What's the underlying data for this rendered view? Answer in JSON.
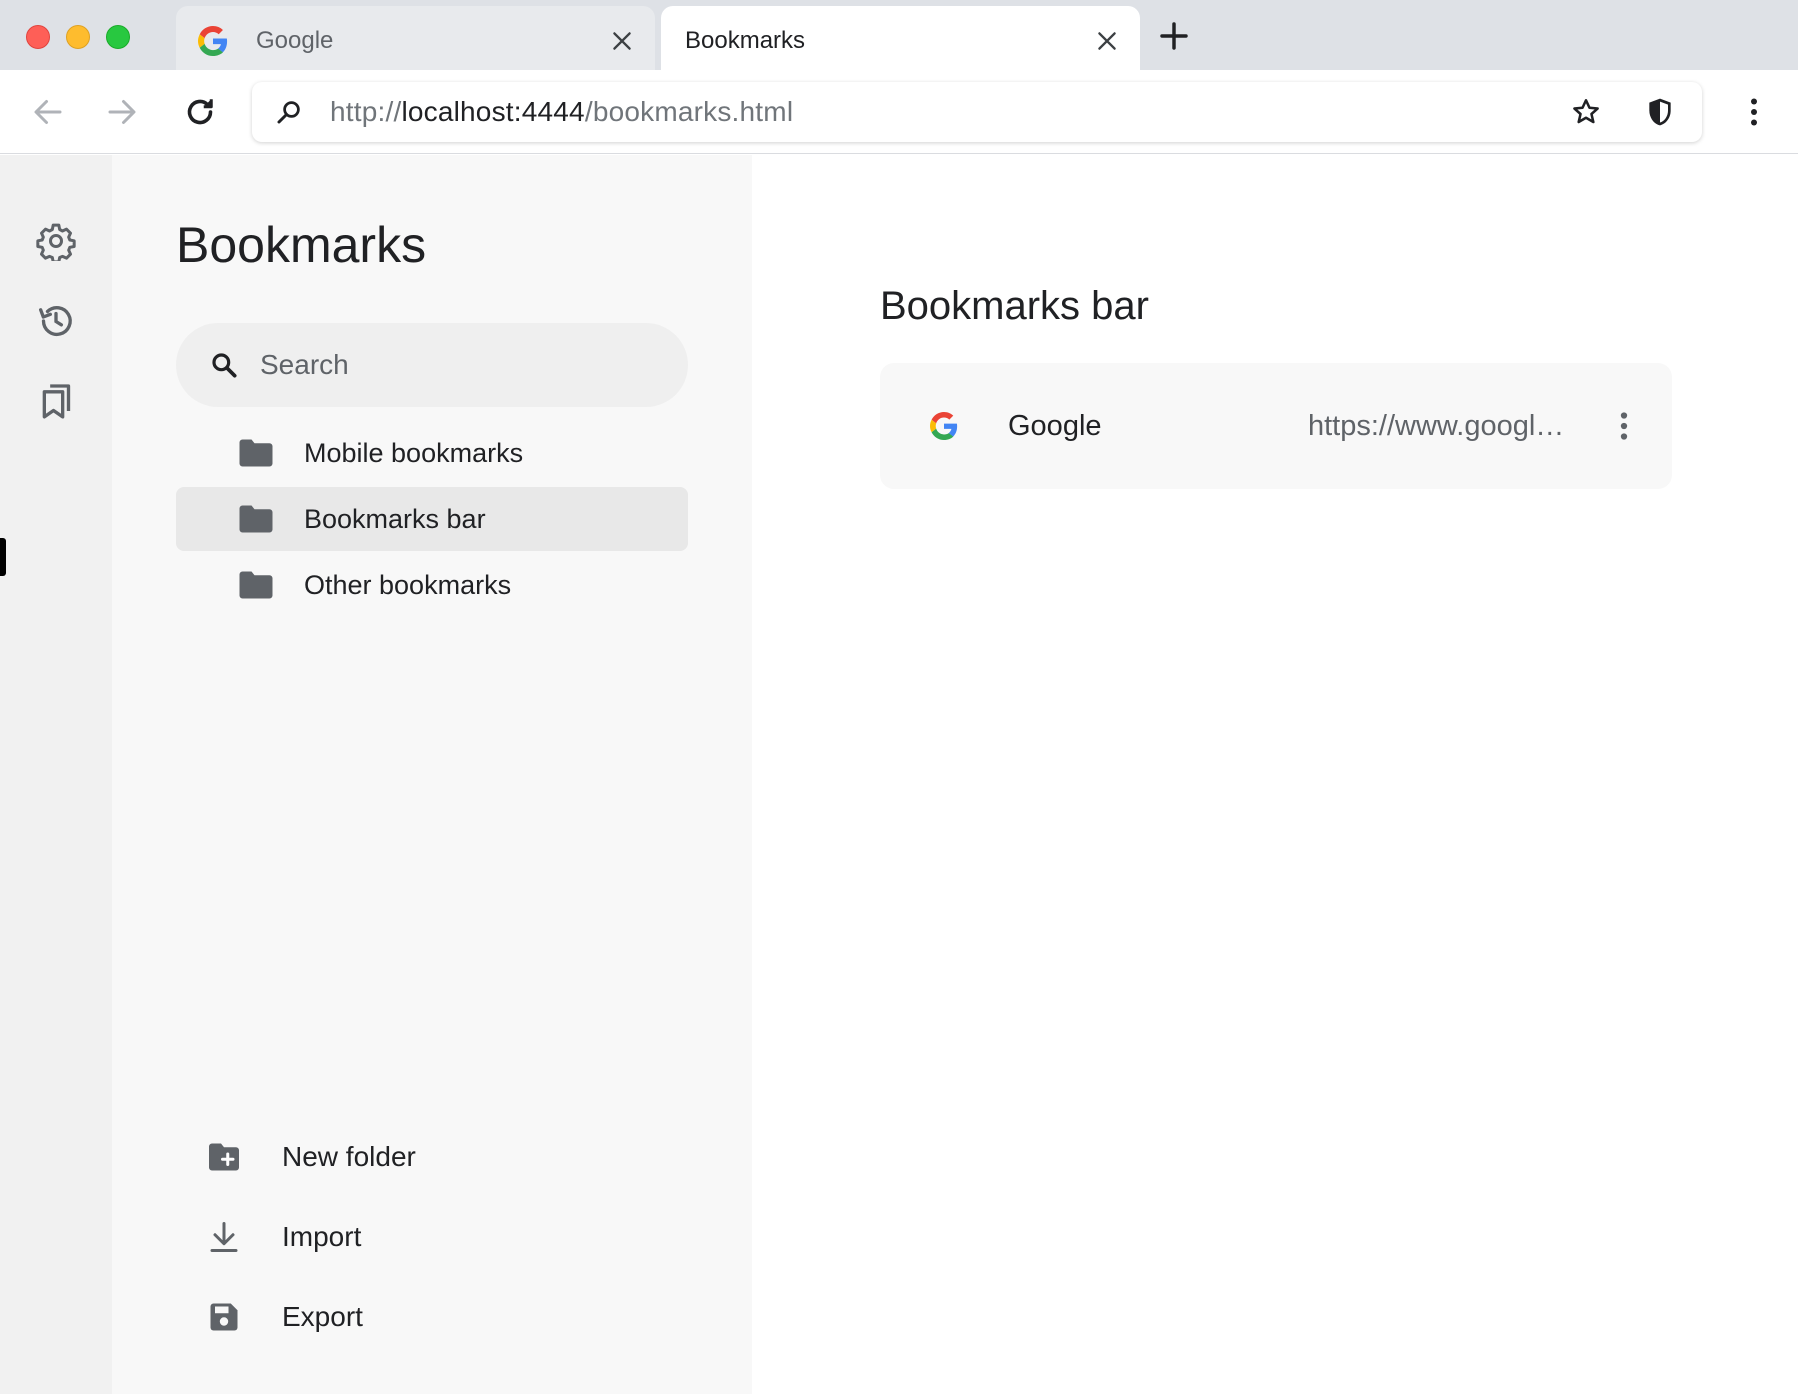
{
  "browser": {
    "tabs": [
      {
        "title": "Google",
        "favicon": "google-g-icon",
        "active": false
      },
      {
        "title": "Bookmarks",
        "active": true
      }
    ],
    "url": {
      "scheme": "http://",
      "host": "localhost:4444",
      "path": "/bookmarks.html"
    },
    "icons": [
      "back-icon",
      "forward-icon",
      "reload-icon",
      "star-icon",
      "shield-icon",
      "more-vert-icon"
    ]
  },
  "rail": {
    "items": [
      {
        "name": "settings",
        "icon": "gear-icon"
      },
      {
        "name": "history",
        "icon": "history-icon"
      },
      {
        "name": "bookmarks",
        "icon": "bookmarks-icon",
        "active": true
      }
    ]
  },
  "sidebar": {
    "title": "Bookmarks",
    "search_placeholder": "Search",
    "folders": [
      {
        "label": "Mobile bookmarks",
        "selected": false
      },
      {
        "label": "Bookmarks bar",
        "selected": true
      },
      {
        "label": "Other bookmarks",
        "selected": false
      }
    ],
    "actions": [
      {
        "label": "New folder",
        "icon": "new-folder-icon"
      },
      {
        "label": "Import",
        "icon": "download-icon"
      },
      {
        "label": "Export",
        "icon": "save-icon"
      }
    ]
  },
  "main": {
    "section_title": "Bookmarks bar",
    "bookmarks": [
      {
        "title": "Google",
        "url": "https://www.google.com/"
      }
    ]
  },
  "colors": {
    "tabstrip": "#dee1e6",
    "rail": "#f1f1f1",
    "sidebar": "#f8f8f8",
    "selected": "#e8e8e8",
    "text": "#202124",
    "muted": "#5f6368"
  }
}
